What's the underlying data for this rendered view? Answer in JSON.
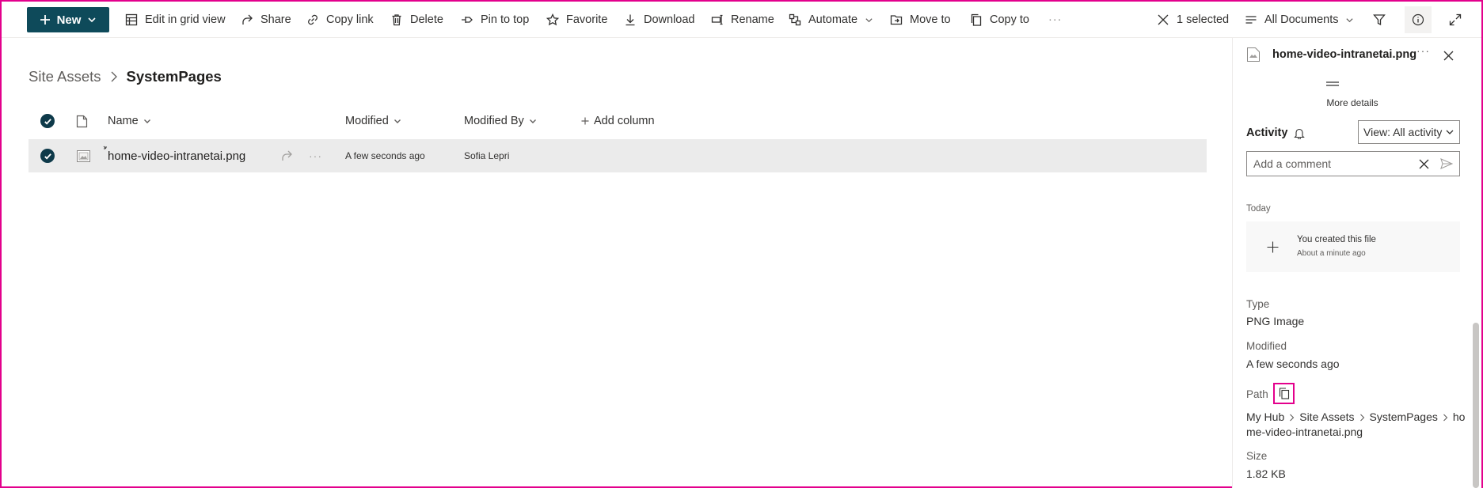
{
  "toolbar": {
    "new_label": "New",
    "edit_grid_label": "Edit in grid view",
    "share_label": "Share",
    "copy_link_label": "Copy link",
    "delete_label": "Delete",
    "pin_label": "Pin to top",
    "favorite_label": "Favorite",
    "download_label": "Download",
    "rename_label": "Rename",
    "automate_label": "Automate",
    "move_label": "Move to",
    "copy_label": "Copy to",
    "more_label": "···",
    "selected_label": "1 selected",
    "view_label": "All Documents"
  },
  "breadcrumb": {
    "parent": "Site Assets",
    "current": "SystemPages"
  },
  "list": {
    "columns": {
      "name": "Name",
      "modified": "Modified",
      "modified_by": "Modified By",
      "add_column": "Add column"
    },
    "rows": [
      {
        "name": "home-video-intranetai.png",
        "modified": "A few seconds ago",
        "modified_by": "Sofia Lepri"
      }
    ]
  },
  "details": {
    "file_name": "home-video-intranetai.png",
    "more_details": "More details",
    "activity_label": "Activity",
    "activity_filter": "View: All activity",
    "comment_placeholder": "Add a comment",
    "today_label": "Today",
    "activity_item": {
      "title": "You created this file",
      "time": "About a minute ago"
    },
    "type_label": "Type",
    "type_value": "PNG Image",
    "modified_label": "Modified",
    "modified_value": "A few seconds ago",
    "path_label": "Path",
    "path": {
      "hub": "My Hub",
      "site": "Site Assets",
      "folder": "SystemPages",
      "file_line1": "ho",
      "file_line2": "me-video-intranetai.png"
    },
    "size_label": "Size",
    "size_value": "1.82 KB"
  },
  "colors": {
    "brand": "#0e4a5a",
    "highlight": "#e3008c",
    "selected_row": "#ebebeb"
  }
}
